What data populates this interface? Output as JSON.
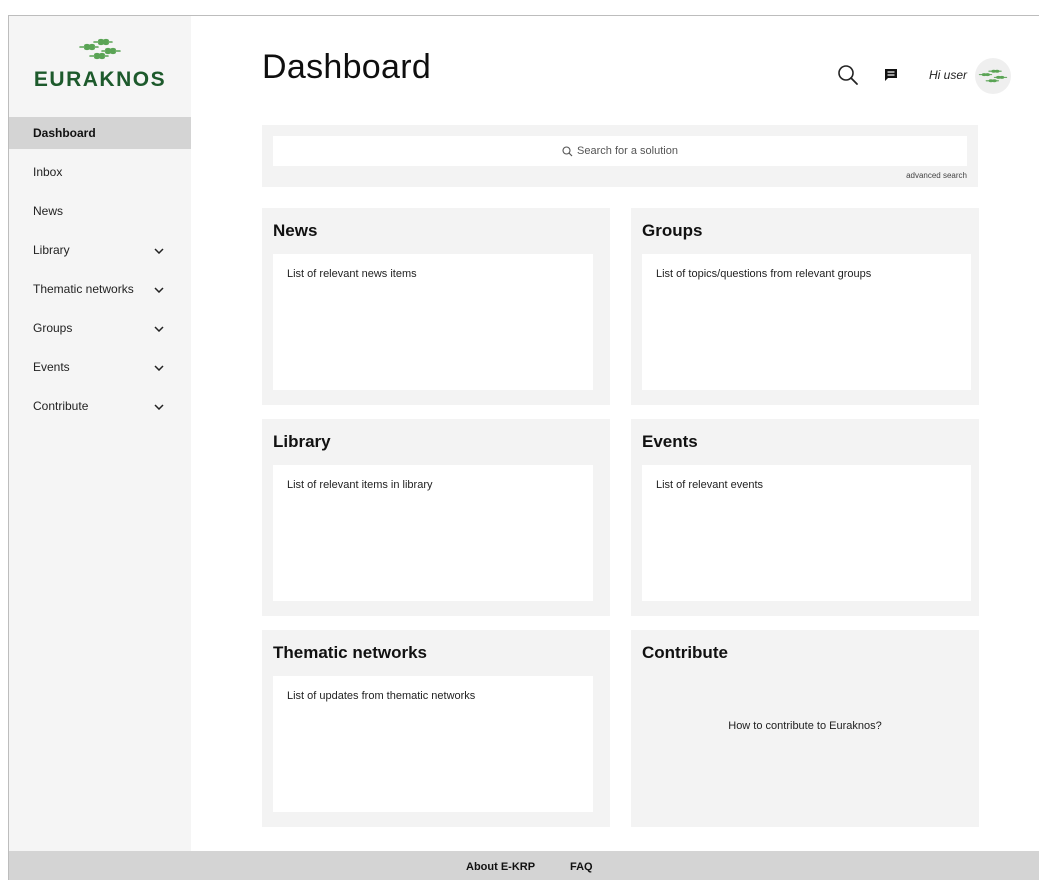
{
  "brand": {
    "name": "EURAKNOS",
    "logo_icon": "wheat-leaf-logo-icon",
    "color": "#1d5a2c",
    "accent": "#5aa455"
  },
  "sidebar": {
    "items": [
      {
        "label": "Dashboard",
        "active": true,
        "expandable": false
      },
      {
        "label": "Inbox",
        "expandable": false
      },
      {
        "label": "News",
        "expandable": false
      },
      {
        "label": "Library",
        "expandable": true
      },
      {
        "label": "Thematic networks",
        "expandable": true
      },
      {
        "label": "Groups",
        "expandable": true
      },
      {
        "label": "Events",
        "expandable": true
      },
      {
        "label": "Contribute",
        "expandable": true
      }
    ]
  },
  "header": {
    "title": "Dashboard",
    "search_icon": "search-icon",
    "chat_icon": "chat-icon",
    "greeting": "Hi user",
    "avatar_icon": "wheat-leaf-logo-icon"
  },
  "search": {
    "placeholder": "Search for a solution",
    "advanced_label": "advanced search"
  },
  "cards": {
    "news": {
      "title": "News",
      "body": "List of relevant news items"
    },
    "groups": {
      "title": "Groups",
      "body": "List of topics/questions from relevant groups"
    },
    "library": {
      "title": "Library",
      "body": "List of relevant items in library"
    },
    "events": {
      "title": "Events",
      "body": "List of relevant events"
    },
    "thematic": {
      "title": "Thematic networks",
      "body": "List of updates from thematic networks"
    },
    "contribute": {
      "title": "Contribute",
      "body": "How to contribute to Euraknos?"
    }
  },
  "footer": {
    "about": "About E-KRP",
    "faq": "FAQ"
  },
  "colors": {
    "sidebar_bg": "#f5f5f5",
    "active_bg": "#d4d4d4",
    "panel_bg": "#f3f3f3",
    "footer_bg": "#d4d4d4"
  }
}
